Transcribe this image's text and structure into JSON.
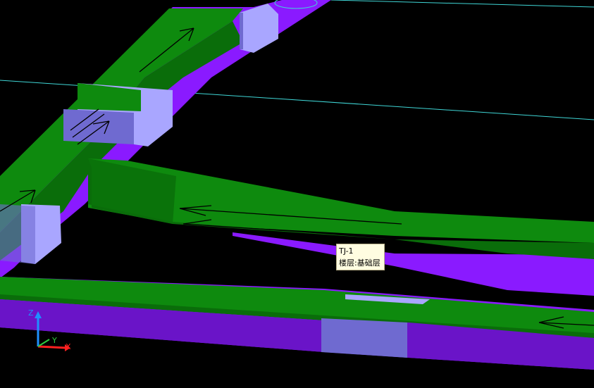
{
  "tooltip": {
    "name": "TJ-1",
    "floor": "楼层:基础层"
  },
  "axes": {
    "z_label": "Z",
    "y_label": "Y",
    "x_label": "X"
  },
  "colors": {
    "background": "#000000",
    "beam_top": "#0e8a0e",
    "beam_top_dark": "#0a6d0a",
    "beam_side": "#8a1aff",
    "beam_side_dark": "#6a14c8",
    "pile_cap": "#a9a6ff",
    "pile_cap_dark": "#6f6ad0",
    "grid_line": "#3fd6d6",
    "axis_z": "#1e90ff",
    "axis_y": "#2ecc40",
    "axis_x": "#ff2020"
  }
}
